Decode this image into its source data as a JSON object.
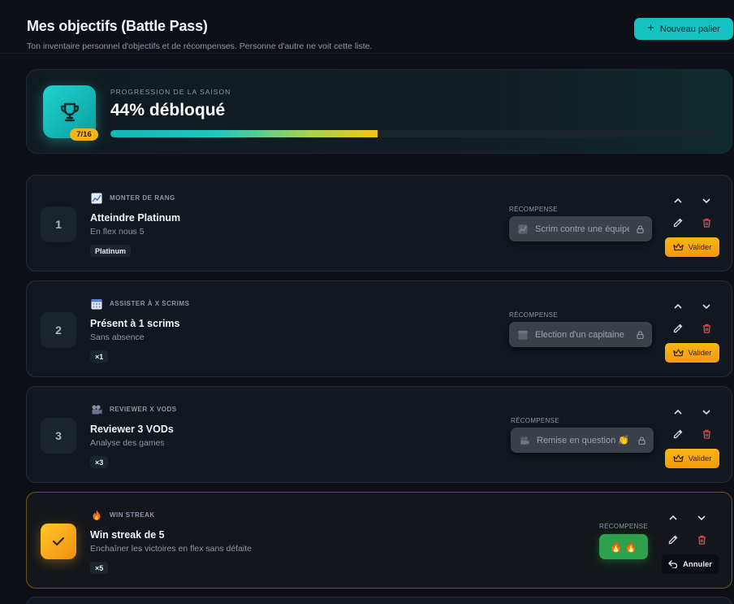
{
  "header": {
    "title": "Mes objectifs (Battle Pass)",
    "subtitle": "Ton inventaire personnel d'objectifs et de récompenses. Personne d'autre ne voit cette liste.",
    "new_button_icon": "plus-icon",
    "new_button_label": "Nouveau palier"
  },
  "progress": {
    "label": "PROGRESSION DE LA SAISON",
    "value_text": "44% débloqué",
    "fraction": 0.44,
    "count": "7/16",
    "icon": "trophy-icon"
  },
  "colors": {
    "accent": "#14c2c2",
    "gold": "#f3b51a",
    "danger": "#e5484d",
    "success": "#2fa14d"
  },
  "objectives": [
    {
      "number": "1",
      "type_icon": "chart-line-icon",
      "type_label": "MONTER DE RANG",
      "title": "Atteindre Platinum",
      "description": "En flex nous 5",
      "chip": "Platinum",
      "reward_label": "RÉCOMPENSE",
      "reward_icon": "chart-line-icon",
      "reward_text": "Scrim contre une équipe",
      "validate_label": "Valider",
      "done": false
    },
    {
      "number": "2",
      "type_icon": "calendar-icon",
      "type_label": "ASSISTER À X SCRIMS",
      "title": "Présent à 1 scrims",
      "description": "Sans absence",
      "chip": "×1",
      "reward_label": "RÉCOMPENSE",
      "reward_icon": "calendar-icon",
      "reward_text": "Election d'un capitaine",
      "validate_label": "Valider",
      "done": false
    },
    {
      "number": "3",
      "type_icon": "video-camera-icon",
      "type_label": "REVIEWER X VODS",
      "title": "Reviewer 3 VODs",
      "description": "Analyse des games",
      "chip": "×3",
      "reward_label": "RÉCOMPENSE",
      "reward_icon": "video-camera-icon",
      "reward_text": "Remise en question 👏",
      "validate_label": "Valider",
      "done": false
    },
    {
      "type_icon": "fire-icon",
      "type_label": "WIN STREAK",
      "title": "Win streak de 5",
      "description": "Enchaîner les victoires en flex sans défaite",
      "chip": "×5",
      "reward_label": "RÉCOMPENSE",
      "reward_text": "🔥 🔥",
      "cancel_label": "Annuler",
      "done": true
    }
  ]
}
